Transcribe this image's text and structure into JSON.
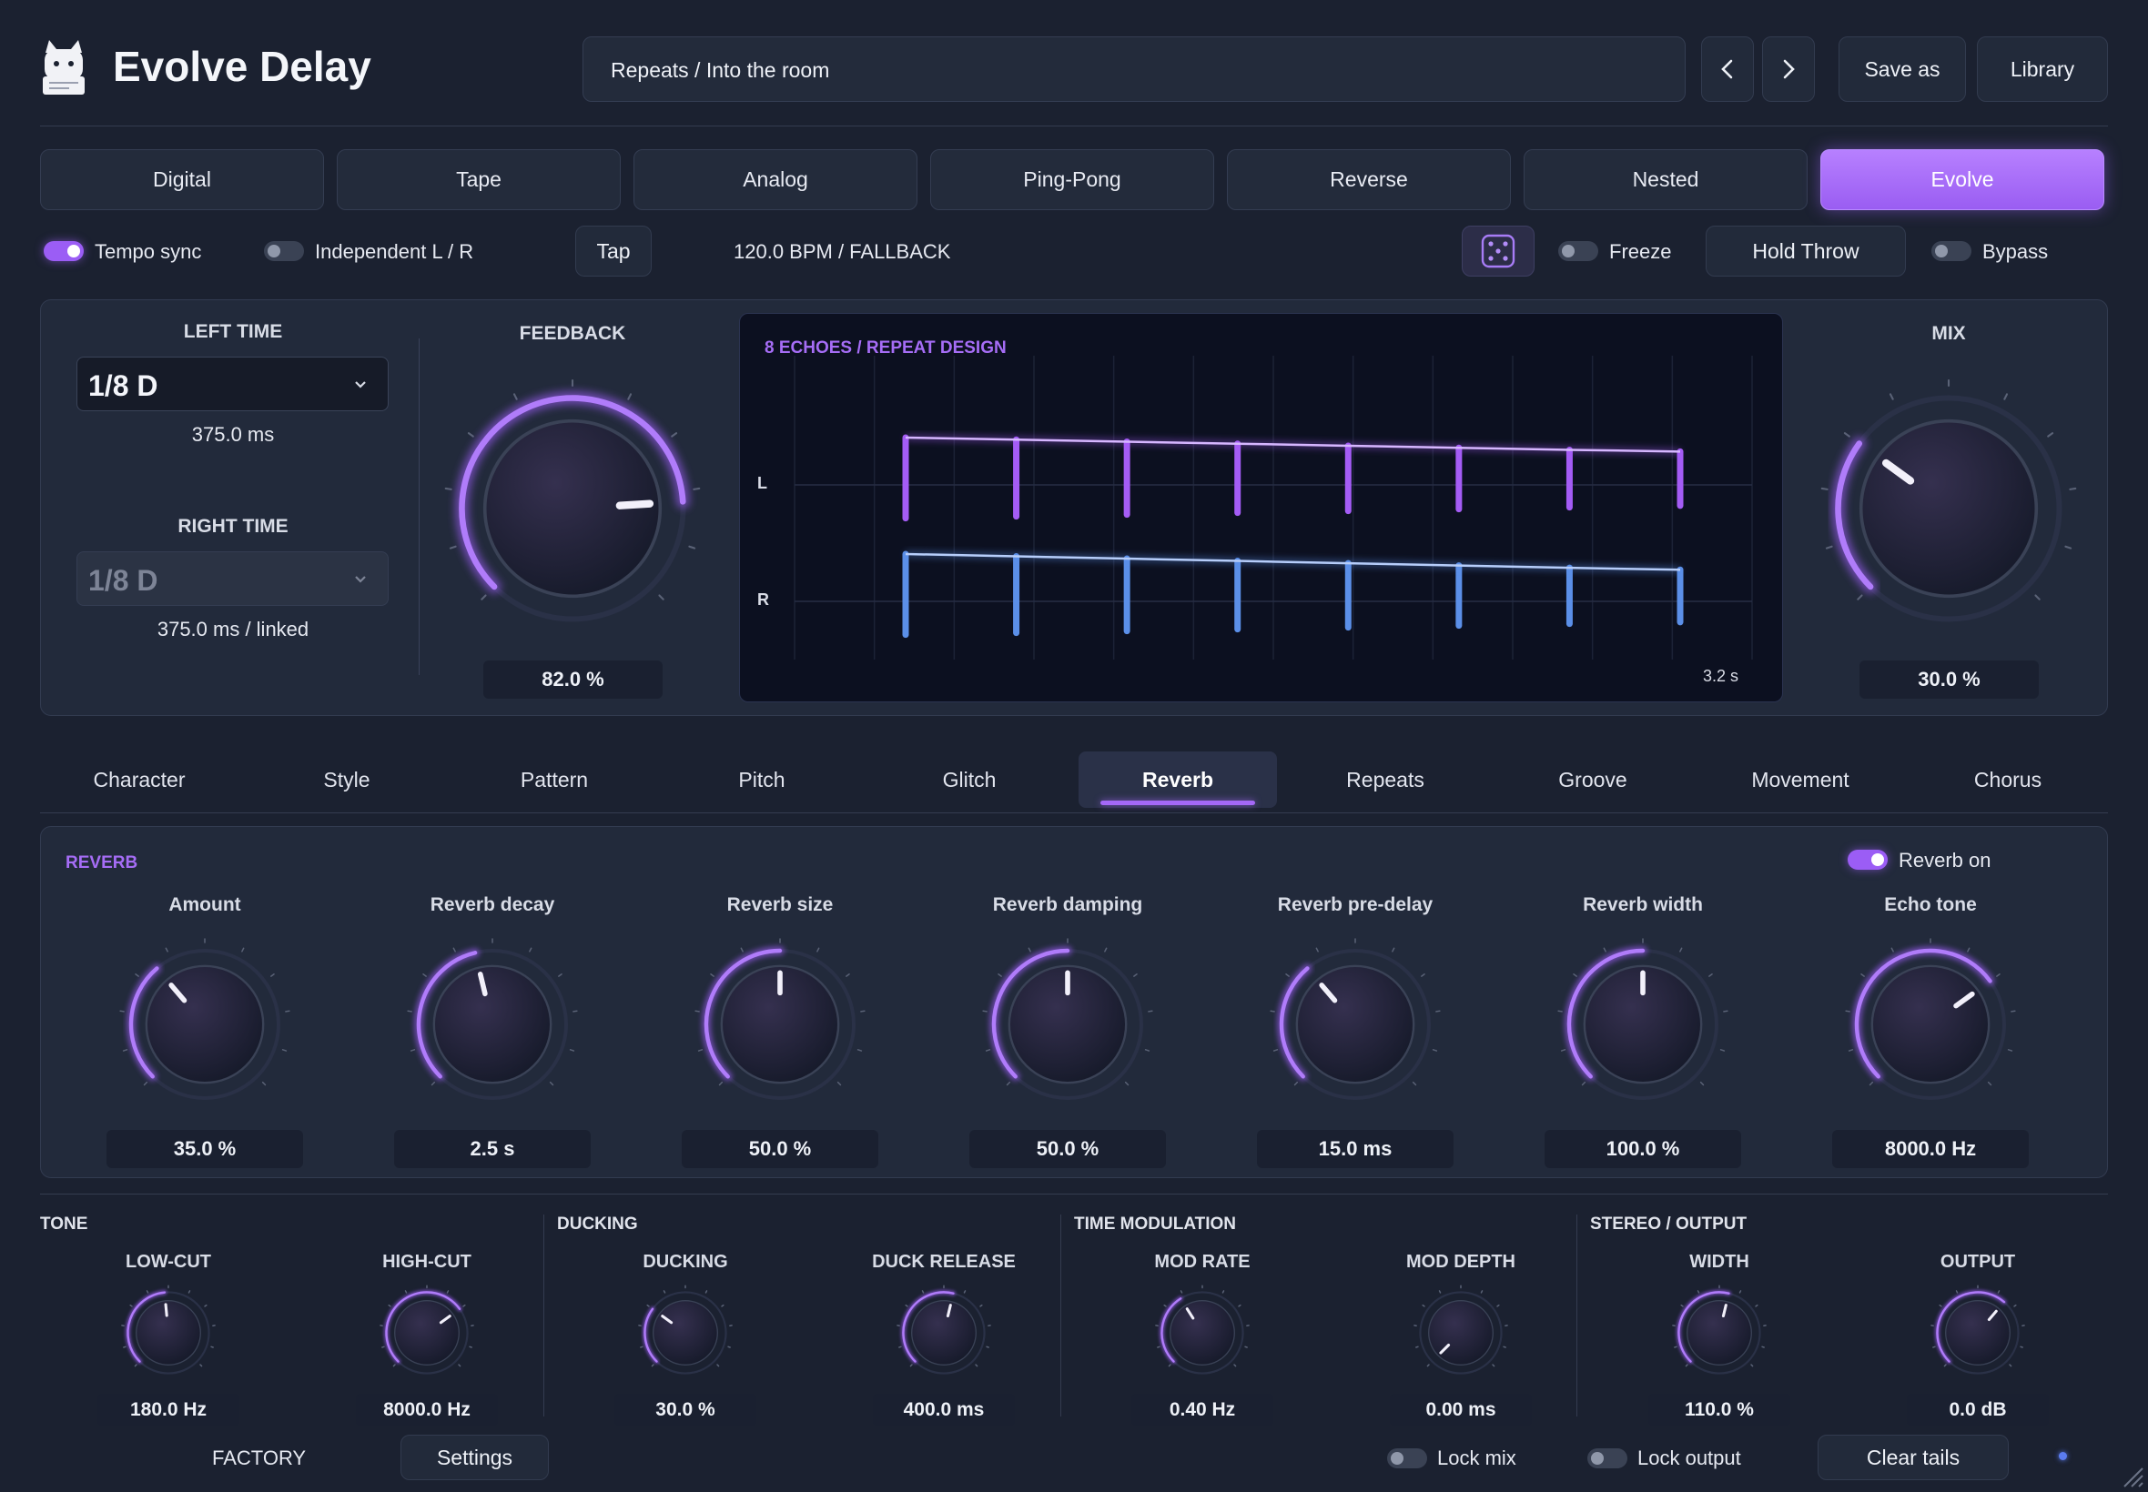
{
  "header": {
    "title": "Evolve Delay",
    "preset": "Repeats / Into the room",
    "prev_icon": "chevron-left-icon",
    "next_icon": "chevron-right-icon",
    "save_as": "Save as",
    "library": "Library"
  },
  "modes": [
    "Digital",
    "Tape",
    "Analog",
    "Ping-Pong",
    "Reverse",
    "Nested",
    "Evolve"
  ],
  "active_mode": "Evolve",
  "sync_row": {
    "tempo_sync": "Tempo sync",
    "tempo_sync_on": true,
    "independent": "Independent L / R",
    "independent_on": false,
    "tap": "Tap",
    "bpm": "120.0 BPM / FALLBACK",
    "dice_icon": "dice-icon",
    "freeze": "Freeze",
    "freeze_on": false,
    "hold_throw": "Hold Throw",
    "bypass": "Bypass",
    "bypass_on": false
  },
  "timing": {
    "left_label": "LEFT TIME",
    "left_value": "1/8 D",
    "left_ms": "375.0 ms",
    "right_label": "RIGHT TIME",
    "right_value": "1/8 D",
    "right_ms": "375.0 ms / linked"
  },
  "feedback": {
    "label": "FEEDBACK",
    "value": "82.0 %",
    "level": 0.82
  },
  "mix": {
    "label": "MIX",
    "value": "30.0 %",
    "level": 0.3
  },
  "display": {
    "title": "8 ECHOES / REPEAT DESIGN",
    "left_channel": "L",
    "right_channel": "R",
    "duration": "3.2 s",
    "echo_count": 8,
    "left_levels": [
      1.0,
      0.93,
      0.86,
      0.79,
      0.72,
      0.65,
      0.58,
      0.52
    ],
    "right_levels": [
      1.0,
      0.93,
      0.86,
      0.79,
      0.72,
      0.65,
      0.58,
      0.52
    ]
  },
  "tabs": [
    "Character",
    "Style",
    "Pattern",
    "Pitch",
    "Glitch",
    "Reverb",
    "Repeats",
    "Groove",
    "Movement",
    "Chorus"
  ],
  "active_tab": "Reverb",
  "reverb": {
    "section": "REVERB",
    "toggle_label": "Reverb on",
    "toggle_on": true,
    "knobs": [
      {
        "label": "Amount",
        "value": "35.0 %",
        "level": 0.35
      },
      {
        "label": "Reverb decay",
        "value": "2.5 s",
        "level": 0.45
      },
      {
        "label": "Reverb size",
        "value": "50.0 %",
        "level": 0.5
      },
      {
        "label": "Reverb damping",
        "value": "50.0 %",
        "level": 0.5
      },
      {
        "label": "Reverb pre-delay",
        "value": "15.0 ms",
        "level": 0.35
      },
      {
        "label": "Reverb width",
        "value": "100.0 %",
        "level": 0.5
      },
      {
        "label": "Echo tone",
        "value": "8000.0 Hz",
        "level": 0.7
      }
    ]
  },
  "bottom": {
    "sections": [
      "TONE",
      "DUCKING",
      "TIME MODULATION",
      "STEREO / OUTPUT"
    ],
    "knobs": [
      {
        "label": "LOW-CUT",
        "value": "180.0 Hz",
        "level": 0.48
      },
      {
        "label": "HIGH-CUT",
        "value": "8000.0 Hz",
        "level": 0.7
      },
      {
        "label": "DUCKING",
        "value": "30.0 %",
        "level": 0.3
      },
      {
        "label": "DUCK RELEASE",
        "value": "400.0 ms",
        "level": 0.55
      },
      {
        "label": "MOD RATE",
        "value": "0.40 Hz",
        "level": 0.38
      },
      {
        "label": "MOD DEPTH",
        "value": "0.00 ms",
        "level": 0.0
      },
      {
        "label": "WIDTH",
        "value": "110.0 %",
        "level": 0.55
      },
      {
        "label": "OUTPUT",
        "value": "0.0 dB",
        "level": 0.65
      }
    ]
  },
  "footer": {
    "factory": "FACTORY",
    "settings": "Settings",
    "lock_mix": "Lock mix",
    "lock_mix_on": false,
    "lock_output": "Lock output",
    "lock_output_on": false,
    "clear_tails": "Clear tails"
  },
  "colors": {
    "accent": "#9b5df5",
    "left_channel": "#a45cf5",
    "right_channel": "#5b8fe8",
    "background": "#1b2130"
  }
}
